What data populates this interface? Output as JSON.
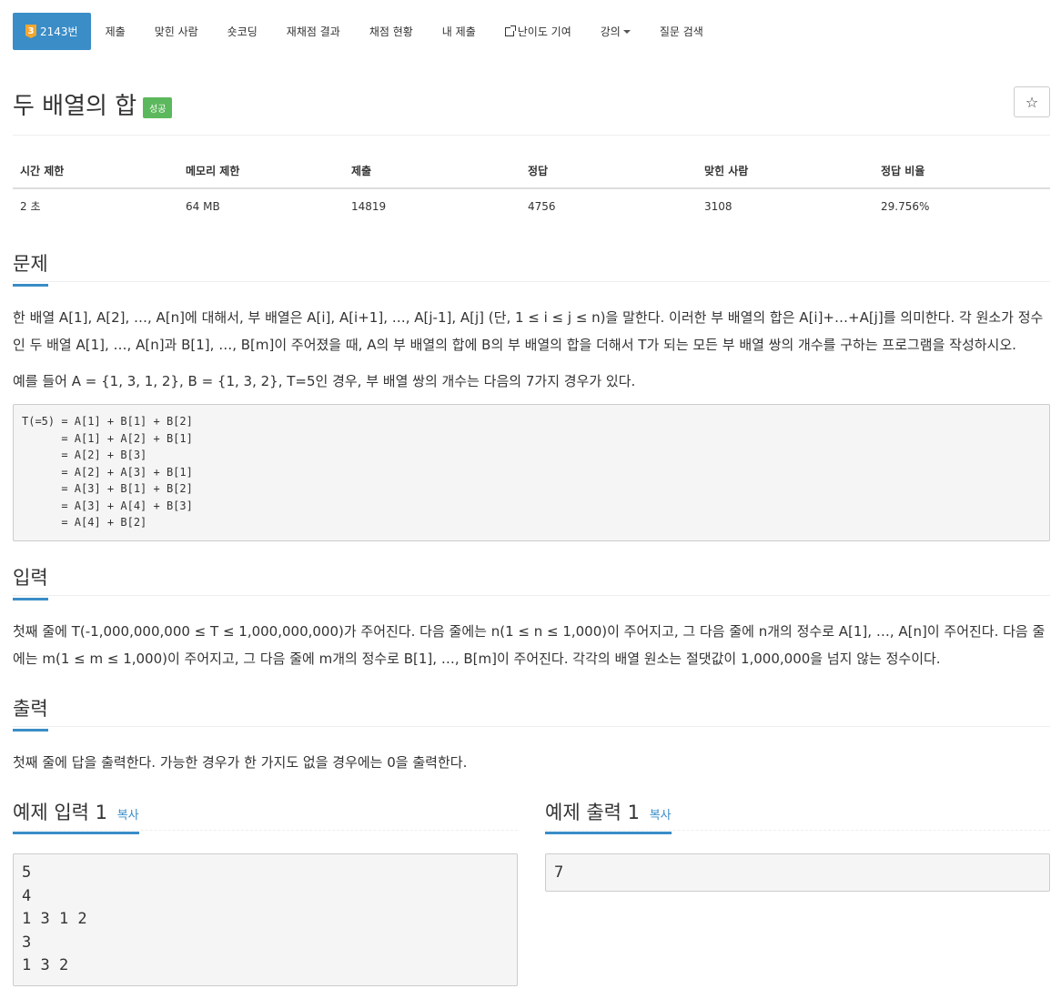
{
  "tabs": {
    "tier": "3",
    "problem_id": "2143번",
    "items": [
      "제출",
      "맞힌 사람",
      "숏코딩",
      "재채점 결과",
      "채점 현황",
      "내 제출",
      "난이도 기여",
      "강의",
      "질문 검색"
    ]
  },
  "title": "두 배열의 합",
  "badge": "성공",
  "star": "☆",
  "info": {
    "headers": [
      "시간 제한",
      "메모리 제한",
      "제출",
      "정답",
      "맞힌 사람",
      "정답 비율"
    ],
    "values": [
      "2 초",
      "64 MB",
      "14819",
      "4756",
      "3108",
      "29.756%"
    ]
  },
  "problem": {
    "heading": "문제",
    "p1": "한 배열 A[1], A[2], …, A[n]에 대해서, 부 배열은 A[i], A[i+1], …, A[j-1], A[j] (단, 1 ≤ i ≤ j ≤ n)을 말한다. 이러한 부 배열의 합은 A[i]+…+A[j]를 의미한다. 각 원소가 정수인 두 배열 A[1], …, A[n]과 B[1], …, B[m]이 주어졌을 때, A의 부 배열의 합에 B의 부 배열의 합을 더해서 T가 되는 모든 부 배열 쌍의 개수를 구하는 프로그램을 작성하시오.",
    "p2": "예를 들어 A = {1, 3, 1, 2}, B = {1, 3, 2}, T=5인 경우, 부 배열 쌍의 개수는 다음의 7가지 경우가 있다.",
    "code": "T(=5) = A[1] + B[1] + B[2]\n      = A[1] + A[2] + B[1]\n      = A[2] + B[3]\n      = A[2] + A[3] + B[1]\n      = A[3] + B[1] + B[2]\n      = A[3] + A[4] + B[3]\n      = A[4] + B[2]"
  },
  "input": {
    "heading": "입력",
    "p": "첫째 줄에 T(-1,000,000,000 ≤ T ≤ 1,000,000,000)가 주어진다. 다음 줄에는 n(1 ≤ n ≤ 1,000)이 주어지고, 그 다음 줄에 n개의 정수로 A[1], …, A[n]이 주어진다. 다음 줄에는 m(1 ≤ m ≤ 1,000)이 주어지고, 그 다음 줄에 m개의 정수로 B[1], …, B[m]이 주어진다. 각각의 배열 원소는 절댓값이 1,000,000을 넘지 않는 정수이다."
  },
  "output": {
    "heading": "출력",
    "p": "첫째 줄에 답을 출력한다. 가능한 경우가 한 가지도 없을 경우에는 0을 출력한다."
  },
  "sample_input": {
    "heading": "예제 입력 1",
    "copy": "복사",
    "text": "5\n4\n1 3 1 2\n3\n1 3 2"
  },
  "sample_output": {
    "heading": "예제 출력 1",
    "copy": "복사",
    "text": "7"
  },
  "colors": {
    "accent": "#3a8dc7",
    "success": "#5cb85c",
    "tier": "#f2a730"
  }
}
